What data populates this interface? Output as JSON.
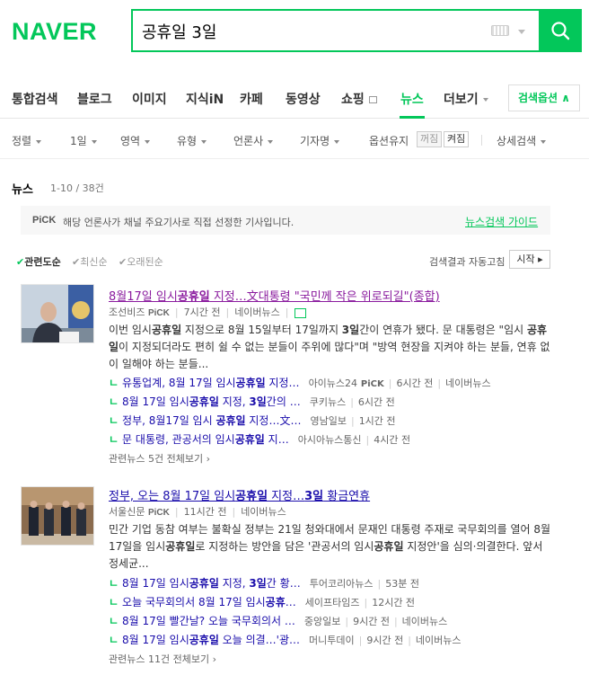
{
  "header": {
    "logo": "NAVER",
    "query": "공휴일 3일"
  },
  "tabs": {
    "items": [
      "통합검색",
      "블로그",
      "이미지",
      "지식iN",
      "카페",
      "동영상",
      "쇼핑",
      "뉴스",
      "더보기"
    ],
    "active": "뉴스",
    "search_options": "검색옵션"
  },
  "filters": {
    "items": [
      "정렬",
      "1일",
      "영역",
      "유형",
      "언론사",
      "기자명"
    ],
    "keep_label": "옵션유지",
    "off": "꺼짐",
    "on": "켜짐",
    "detail": "상세검색"
  },
  "news": {
    "heading": "뉴스",
    "count": "1-10 / 38건",
    "pick_logo": "PiCK",
    "pick_text": "해당 언론사가 채널 주요기사로 직접 선정한 기사입니다.",
    "pick_guide": "뉴스검색 가이드",
    "sort": [
      "관련도순",
      "최신순",
      "오래된순"
    ],
    "auto_refresh": "검색결과 자동고침",
    "start": "시작"
  },
  "articles": [
    {
      "title_parts": [
        "8월17일 임시",
        "공휴일",
        " 지정…文대통령 \"국민께 작은 위로되길\"(종합)"
      ],
      "source": "조선비즈",
      "pick": "PiCK",
      "time": "7시간 전",
      "naver": "네이버뉴스",
      "desc_parts": [
        "이번 임시",
        "공휴일",
        " 지정으로 8월 15일부터 17일까지 ",
        "3일",
        "간이 연휴가 됐다. 문 대통령은 \"임시 ",
        "공휴일",
        "이 지정되더라도 편히 쉴 수 없는 분들이 주위에 많다\"며 \"방역 현장을 지켜야 하는 분들, 연휴 없이 일해야 하는 분들..."
      ],
      "related": [
        {
          "pre": "유통업계, 8월 17일 임시",
          "bold": "공휴일",
          "post": " 지정…",
          "source": "아이뉴스24",
          "pick": "PiCK",
          "time": "6시간 전",
          "naver": "네이버뉴스"
        },
        {
          "pre": "8월 17일 임시",
          "bold": "공휴일",
          "post": " 지정, ",
          "bold2": "3일",
          "post2": "간의 …",
          "source": "쿠키뉴스",
          "time": "6시간 전"
        },
        {
          "pre": "정부, 8월17일 임시 ",
          "bold": "공휴일",
          "post": " 지정…文…",
          "source": "영남일보",
          "time": "1시간 전"
        },
        {
          "pre": "문 대통령, 관공서의 임시",
          "bold": "공휴일",
          "post": " 지…",
          "source": "아시아뉴스통신",
          "time": "4시간 전"
        }
      ],
      "more": "관련뉴스 5건 전체보기"
    },
    {
      "title_parts": [
        "정부, 오는 8월 17일 임시",
        "공휴일",
        " 지정…",
        "3일",
        " 황금연휴"
      ],
      "source": "서울신문",
      "pick": "PiCK",
      "time": "11시간 전",
      "naver": "네이버뉴스",
      "desc_parts": [
        "민간 기업 동참 여부는 불확실 정부는 21일 청와대에서 문재인 대통령 주재로 국무회의를 열어 8월 17일을 임시",
        "공휴일",
        "로 지정하는 방안을 담은 '관공서의 임시",
        "공휴일",
        " 지정안'을 심의·의결한다. 앞서 정세균..."
      ],
      "related": [
        {
          "pre": "8월 17일 임시",
          "bold": "공휴일",
          "post": " 지정, ",
          "bold2": "3일",
          "post2": "간 황…",
          "source": "투어코리아뉴스",
          "time": "53분 전"
        },
        {
          "pre": "오늘 국무회의서 8월 17일 임시",
          "bold": "공휴",
          "post": "…",
          "source": "세이프타임즈",
          "time": "12시간 전"
        },
        {
          "pre": "8월 17일 빨간날? 오늘 국무회의서 …",
          "source": "중앙일보",
          "time": "9시간 전",
          "naver": "네이버뉴스"
        },
        {
          "pre": "8월 17일 임시",
          "bold": "공휴일",
          "post": " 오늘 의결…'광…",
          "source": "머니투데이",
          "time": "9시간 전",
          "naver": "네이버뉴스"
        }
      ],
      "more": "관련뉴스 11건 전체보기"
    }
  ]
}
